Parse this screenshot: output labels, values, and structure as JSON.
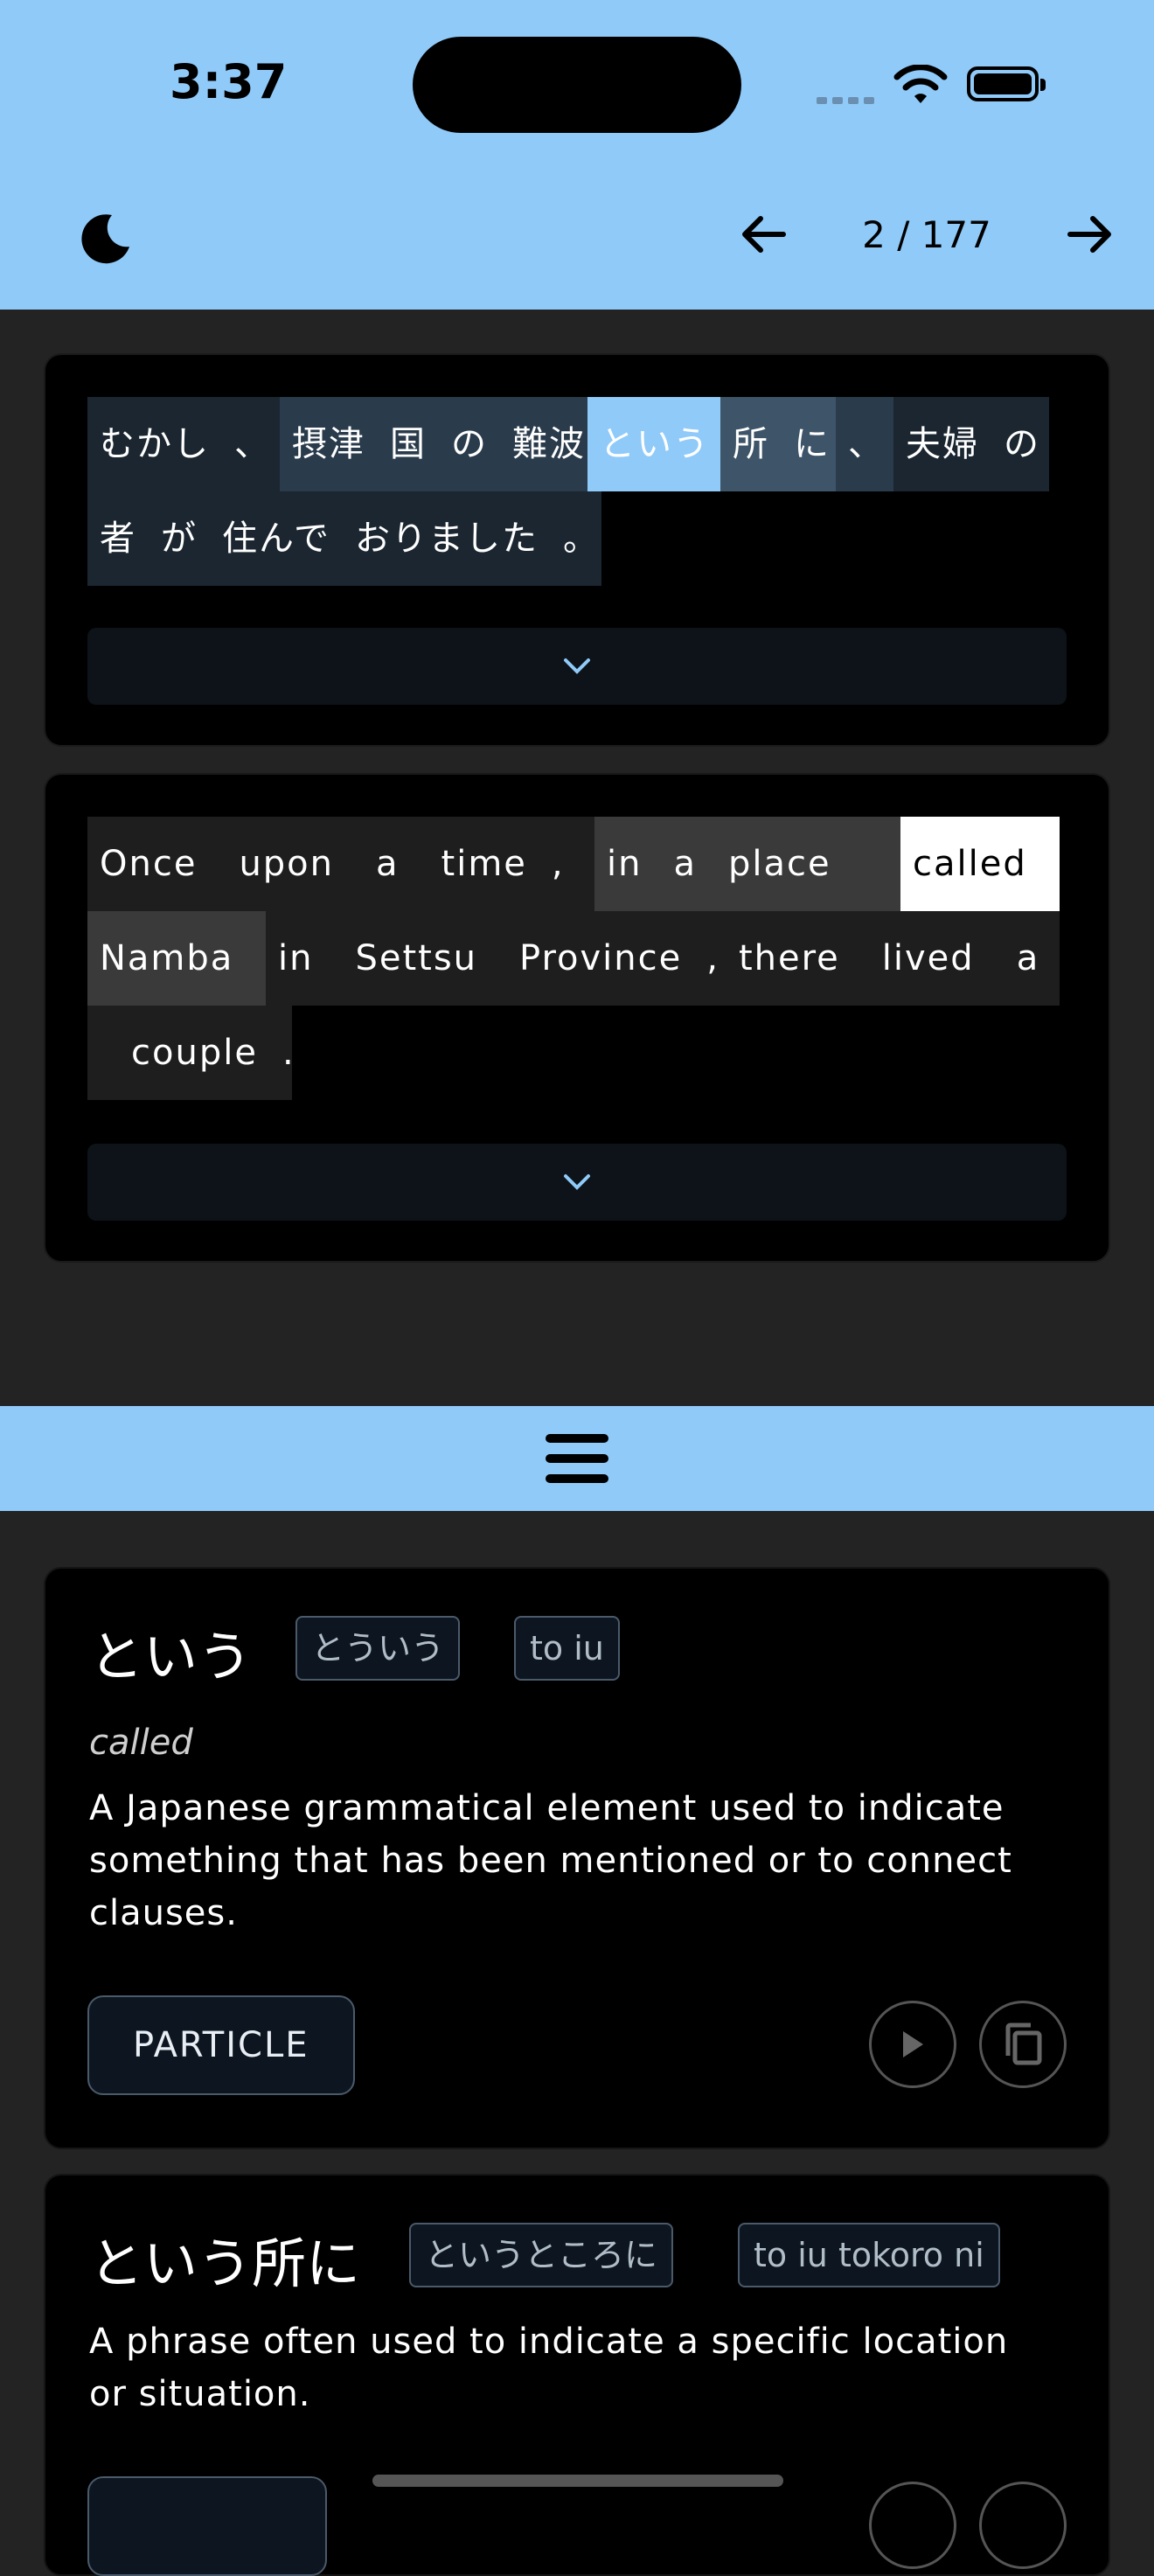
{
  "status": {
    "time": "3:37"
  },
  "header": {
    "page_indicator": "2 / 177"
  },
  "japanese_tokens": [
    "むかし",
    "、",
    "摂津",
    "国",
    "の",
    "難波",
    "という",
    "所",
    "に",
    "、",
    "夫婦",
    "の",
    "者",
    "が",
    "住んで",
    "おりました",
    "。"
  ],
  "english_tokens": [
    "Once",
    "upon",
    "a",
    "time",
    ",",
    "in",
    "a",
    "place",
    "called",
    "Namba",
    "in",
    "Settsu",
    "Province",
    ",",
    "there",
    "lived",
    "a",
    "couple",
    "."
  ],
  "definitions": [
    {
      "term": "という",
      "reading": "とういう",
      "romaji": "to iu",
      "meaning": "called",
      "description": "A Japanese grammatical element used to indicate something that has been mentioned or to connect clauses.",
      "part_of_speech": "PARTICLE"
    },
    {
      "term": "という所に",
      "reading": "というところに",
      "romaji": "to iu tokoro ni",
      "description": "A phrase often used to indicate a specific location or situation."
    }
  ],
  "icons": {
    "theme": "moon-icon",
    "prev": "arrow-left-icon",
    "next": "arrow-right-icon",
    "expand": "chevron-down-icon",
    "menu": "hamburger-icon",
    "play": "play-icon",
    "copy": "copy-icon"
  },
  "colors": {
    "accent": "#90caf9",
    "background": "#232323",
    "card": "#000000"
  }
}
